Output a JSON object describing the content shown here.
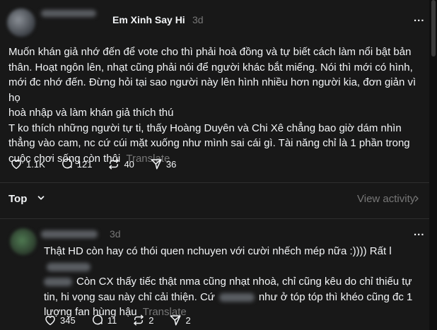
{
  "post": {
    "username": "Em Xinh Say Hi",
    "time": "3d",
    "more": "...",
    "line1": "Muốn khán giả nhớ đến để vote cho thì phải hoà đồng và tự biết cách làm nổi bật bản",
    "line2": "thân. Hoạt ngôn lên, nhạt cũng phải nói để người khác bắt miếng. Nói thì mới có hình,",
    "line3": "mới đc nhớ đến. Đừng hỏi tại sao người này lên hình nhiều hơn người kia, đơn giản vì họ",
    "line4": "hoà nhập và làm khán giả thích thú",
    "line5": "T ko thích những người tự ti, thấy Hoàng Duyên và Chi Xê chẳng bao giờ dám nhìn",
    "line6": "thẳng vào cam, nc cứ cúi mặt xuống như mình sai cái gì. Tài năng chỉ là 1 phần trong",
    "line7": "cuộc chơi sống còn thôi",
    "translate": "Translate",
    "likes": "1.1K",
    "comments": "121",
    "reposts": "40",
    "shares": "36"
  },
  "sort": {
    "top_label": "Top",
    "view_activity": "View activity"
  },
  "reply": {
    "time": "3d",
    "more": "...",
    "line1a": "Thật HD còn hay có thói quen nchuyen với cười nhếch mép nữa :)))) Rất l",
    "line2": "Còn CX thấy tiếc thật nma cũng nhạt nhoà, chỉ cũng kêu do chỉ thiếu tự",
    "line3a": "tin, hi vọng sau này chỉ cải thiện. Cứ",
    "line3b": "như ở tóp tóp thì khéo cũng đc 1",
    "line4": "lượng fan hùng hậu",
    "translate": "Translate",
    "likes": "345",
    "comments": "11",
    "reposts": "2",
    "shares": "2"
  },
  "icons": {
    "like": "heart-icon",
    "comment": "comment-bubble-icon",
    "repost": "repost-arrows-icon",
    "share": "send-paper-plane-icon",
    "top_chevron": "chevron-down-icon",
    "view_chevron": "chevron-right-icon"
  },
  "colors": {
    "background": "#181818",
    "text": "#f3f5f7",
    "muted": "#777777",
    "divider": "#2e2e2e"
  }
}
